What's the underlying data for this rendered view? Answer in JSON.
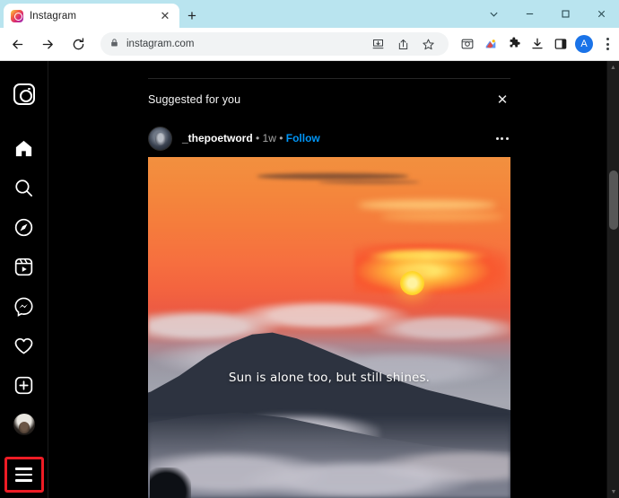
{
  "browser": {
    "tab": {
      "title": "Instagram",
      "favicon": "instagram-favicon",
      "close": "✕"
    },
    "newtab_label": "+",
    "window_controls": {
      "tab_search": "tab-search-chevron",
      "minimize": "minimize",
      "maximize": "maximize",
      "close": "close"
    },
    "nav": {
      "back": "back-arrow",
      "forward": "forward-arrow",
      "reload": "reload-arrow"
    },
    "omnibox": {
      "lock": "lock-icon",
      "url": "instagram.com"
    },
    "omni_actions": [
      {
        "name": "install-app-icon"
      },
      {
        "name": "share-icon"
      },
      {
        "name": "bookmark-star-icon"
      }
    ],
    "toolbar_icons": [
      {
        "name": "screen-capture-icon"
      },
      {
        "name": "extension-colored-icon"
      },
      {
        "name": "extensions-puzzle-icon"
      },
      {
        "name": "downloads-icon"
      },
      {
        "name": "side-panel-icon"
      },
      {
        "name": "profile-avatar",
        "label": "A"
      },
      {
        "name": "chrome-menu-icon"
      }
    ]
  },
  "instagram": {
    "sidebar": {
      "logo": "instagram-logo",
      "items": [
        {
          "name": "home-icon",
          "label": "Home"
        },
        {
          "name": "search-icon",
          "label": "Search"
        },
        {
          "name": "explore-compass-icon",
          "label": "Explore"
        },
        {
          "name": "reels-icon",
          "label": "Reels"
        },
        {
          "name": "messenger-icon",
          "label": "Messages"
        },
        {
          "name": "heart-icon",
          "label": "Notifications"
        },
        {
          "name": "plus-create-icon",
          "label": "Create"
        },
        {
          "name": "profile-avatar",
          "label": "Profile"
        }
      ],
      "more_menu": {
        "name": "hamburger-menu-icon",
        "label": "More",
        "highlight_color": "#ee1c25"
      }
    },
    "feed": {
      "suggested_heading": "Suggested for you",
      "dismiss": "✕",
      "post": {
        "username": "_thepoetword",
        "separator1": " • ",
        "timestamp": "1w",
        "separator2": " • ",
        "follow_label": "Follow",
        "follow_color": "#0095f6",
        "more_options": "post-options",
        "image_caption": "Sun is alone too, but still shines.",
        "image_alt": "sunset-over-clouds-photo"
      }
    },
    "scrollbar": {
      "up": "▲",
      "down": "▼"
    }
  }
}
